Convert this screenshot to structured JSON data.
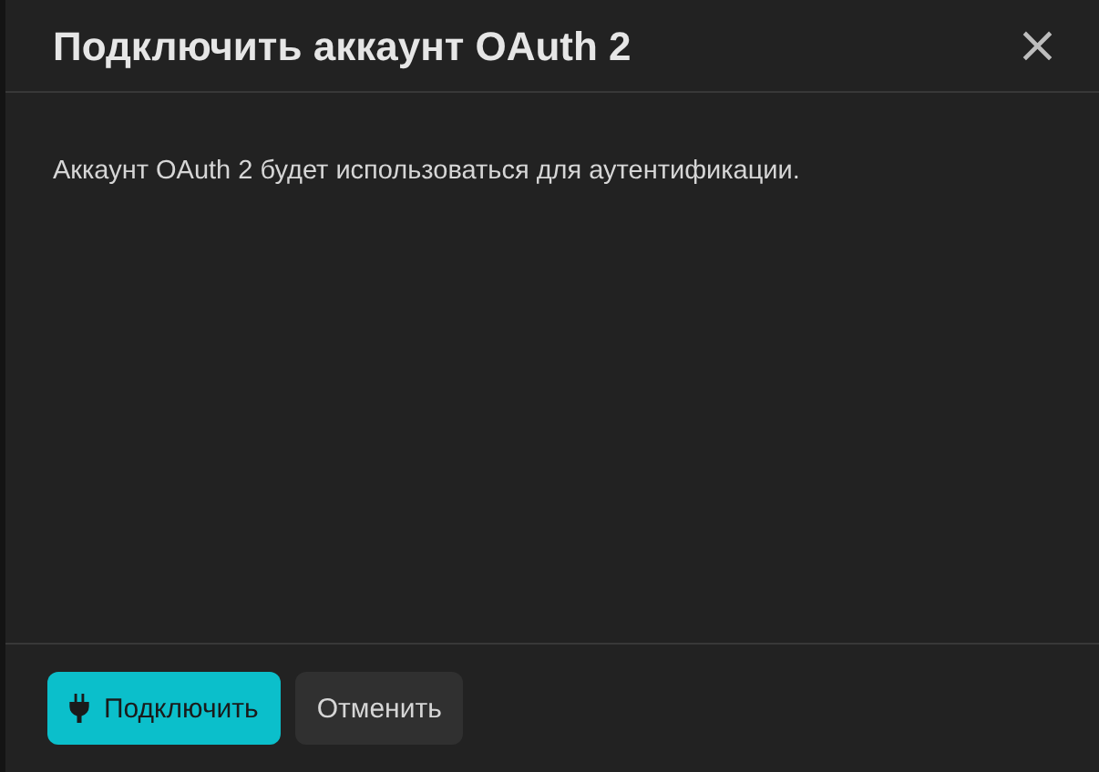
{
  "dialog": {
    "title": "Подключить аккаунт OAuth 2",
    "close": "×",
    "message": "Аккаунт OAuth 2 будет использоваться для аутентификации.",
    "buttons": [
      {
        "label": "Подключить",
        "kind": "primary"
      },
      {
        "label": "Отменить",
        "kind": "secondary"
      }
    ]
  }
}
